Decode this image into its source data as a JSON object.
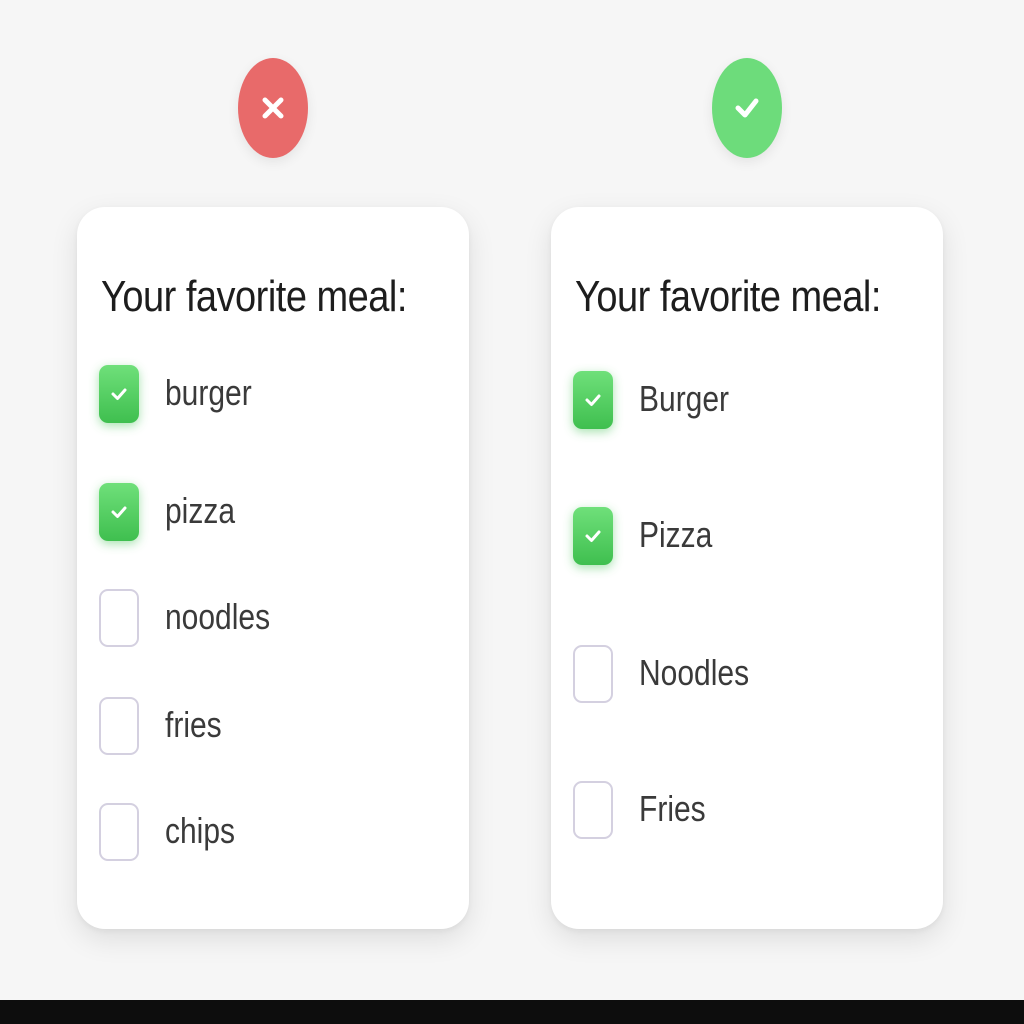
{
  "colors": {
    "bad": "#e86a6a",
    "good": "#6ddc7b",
    "checkbox_checked": "#4cc85a",
    "checkbox_border": "#d4d0e0"
  },
  "left_card": {
    "verdict_icon": "close-icon",
    "title": "Your favorite meal:",
    "options": [
      {
        "label": "burger",
        "checked": true
      },
      {
        "label": "pizza",
        "checked": true
      },
      {
        "label": "noodles",
        "checked": false
      },
      {
        "label": "fries",
        "checked": false
      },
      {
        "label": "chips",
        "checked": false
      }
    ]
  },
  "right_card": {
    "verdict_icon": "check-icon",
    "title": "Your favorite meal:",
    "options": [
      {
        "label": "Burger",
        "checked": true
      },
      {
        "label": "Pizza",
        "checked": true
      },
      {
        "label": "Noodles",
        "checked": false
      },
      {
        "label": "Fries",
        "checked": false
      }
    ]
  }
}
